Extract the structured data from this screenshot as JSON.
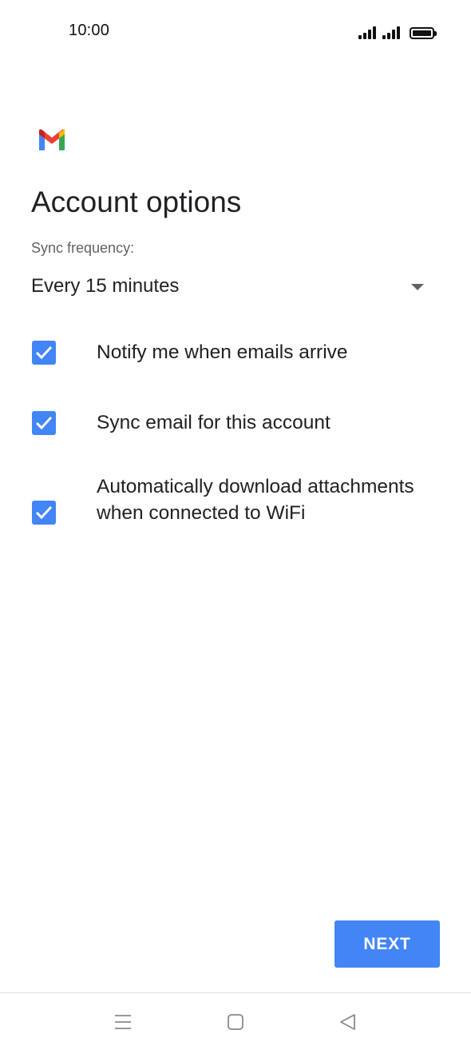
{
  "status_bar": {
    "time": "10:00",
    "icons": [
      "signal-icon",
      "signal-icon",
      "battery-icon"
    ]
  },
  "app": {
    "logo_icon": "gmail-logo",
    "colors": {
      "accent": "#4285f4",
      "text": "#202124",
      "secondary_text": "#5f6368"
    }
  },
  "page": {
    "title": "Account options"
  },
  "sync": {
    "label": "Sync frequency:",
    "value": "Every 15 minutes"
  },
  "options": [
    {
      "label": "Notify me when emails arrive",
      "checked": true
    },
    {
      "label": "Sync email for this account",
      "checked": true
    },
    {
      "label": "Automatically download attachments when connected to WiFi",
      "checked": true
    }
  ],
  "actions": {
    "next_label": "NEXT"
  },
  "nav_bar": {
    "icons": [
      "menu-icon",
      "home-icon",
      "back-icon"
    ]
  }
}
